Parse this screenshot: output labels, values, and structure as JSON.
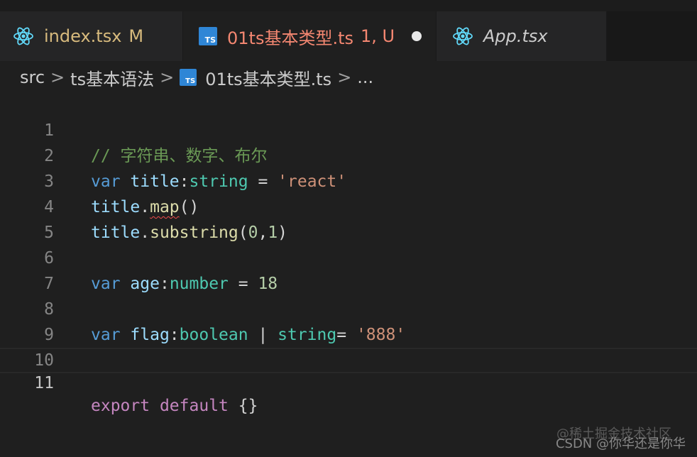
{
  "tabs": [
    {
      "label": "index.tsx",
      "status": "M",
      "icon": "react-icon",
      "active": false
    },
    {
      "label": "01ts基本类型.ts",
      "status": "1, U",
      "icon": "typescript-file-icon",
      "active": true,
      "dirty": true
    },
    {
      "label": "App.tsx",
      "icon": "react-icon",
      "active": false
    }
  ],
  "breadcrumb": {
    "folder1": "src",
    "folder2": "ts基本语法",
    "file": "01ts基本类型.ts",
    "more": "...",
    "separator": ">"
  },
  "ts_icon_text": "TS",
  "code": {
    "l1": {
      "num": "1",
      "comment": "// 字符串、数字、布尔"
    },
    "l2": {
      "num": "2",
      "kw": "var",
      "name": "title",
      "colon": ":",
      "type": "string",
      "eq": " = ",
      "str": "'react'"
    },
    "l3": {
      "num": "3",
      "obj": "title",
      "dot": ".",
      "func": "map",
      "paren": "()"
    },
    "l4": {
      "num": "4",
      "obj": "title",
      "dot": ".",
      "func": "substring",
      "open": "(",
      "a": "0",
      "comma": ",",
      "b": "1",
      "close": ")"
    },
    "l5": {
      "num": "5"
    },
    "l6": {
      "num": "6",
      "kw": "var",
      "name": "age",
      "colon": ":",
      "type": "number",
      "eq": " = ",
      "val": "18"
    },
    "l7": {
      "num": "7"
    },
    "l8": {
      "num": "8",
      "kw": "var",
      "name": "flag",
      "colon": ":",
      "type1": "boolean",
      "pipe": " | ",
      "type2": "string",
      "eq": "= ",
      "str": "'888'"
    },
    "l9": {
      "num": "9"
    },
    "l10": {
      "num": "10"
    },
    "l11": {
      "num": "11",
      "kw1": "export",
      "kw2": "default",
      "braces": "{}"
    }
  },
  "watermark": {
    "line1": "@稀土掘金技术社区",
    "line2": "CSDN @你华还是你华"
  },
  "colors": {
    "editor_bg": "#1f1f1f",
    "modified": "#d7ba7d",
    "error": "#f48771",
    "ts_blue": "#2f86d6",
    "react_blue": "#61dafb"
  }
}
